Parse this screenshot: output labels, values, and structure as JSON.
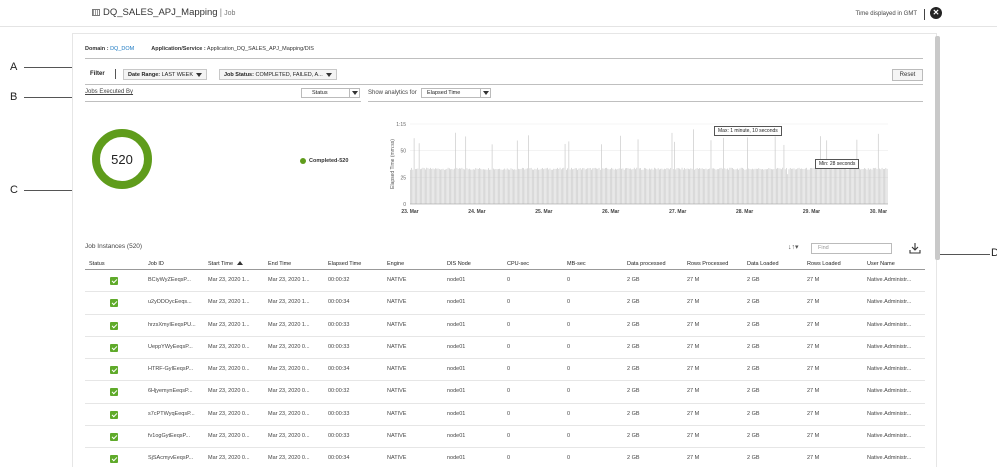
{
  "header": {
    "title": "DQ_SALES_APJ_Mapping",
    "subtitle": "Job",
    "time_note": "Time displayed in GMT"
  },
  "callouts": {
    "a": "A",
    "b": "B",
    "c": "C",
    "d": "D"
  },
  "domain": {
    "domain_label": "Domain :",
    "domain_value": "DQ_DOM",
    "service_label": "Application/Service :",
    "service_value": "Application_DQ_SALES_APJ_Mapping/DIS"
  },
  "filter": {
    "label": "Filter",
    "date_range_label": "Date Range:",
    "date_range_value": "LAST WEEK",
    "job_status_label": "Job Status:",
    "job_status_value": "COMPLETED, FAILED, A...",
    "reset_label": "Reset"
  },
  "summary": {
    "jobs_executed_by": "Jobs Executed By",
    "group_by_select": "Status",
    "analytics_label": "Show analytics for",
    "analytics_select": "Elapsed Time",
    "donut_total": "520",
    "donut_fraction_completed": 1.0,
    "legend": "Completed-520",
    "color_completed": "#5f9c1b"
  },
  "chart_data": {
    "type": "bar",
    "ylabel": "Elapsed Time (mm:ss)",
    "y_ticks": [
      "0",
      "25",
      "50",
      "1:15"
    ],
    "x_ticks": [
      "23. Mar",
      "24. Mar",
      "25. Mar",
      "26. Mar",
      "27. Mar",
      "28. Mar",
      "29. Mar",
      "30. Mar"
    ],
    "ylim_seconds": [
      0,
      75
    ],
    "bar_count": 520,
    "typical_value_seconds": 33,
    "max_tooltip": "Max: 1 minute, 10 seconds",
    "min_tooltip": "Min: 28 seconds",
    "max_value_seconds": 70,
    "min_value_seconds": 28
  },
  "table": {
    "title": "Job Instances (520)",
    "find_placeholder": "Find",
    "sort_icon": "sort-icon",
    "download_icon": "download-icon",
    "columns": [
      "Status",
      "Job ID",
      "Start Time",
      "End Time",
      "Elapsed Time",
      "Engine",
      "DIS Node",
      "CPU-sec",
      "MB-sec",
      "Data processed",
      "Rows Processed",
      "Data Loaded",
      "Rows Loaded",
      "User Name"
    ],
    "rows": [
      [
        "",
        "BCiyWyZEeqsP...",
        "Mar 23, 2020 1...",
        "Mar 23, 2020 1...",
        "00:00:32",
        "NATIVE",
        "node01",
        "0",
        "0",
        "2 GB",
        "27 M",
        "2 GB",
        "27 M",
        "Native.Administr..."
      ],
      [
        "",
        "u2yDDOycEeqs...",
        "Mar 23, 2020 1...",
        "Mar 23, 2020 1...",
        "00:00:34",
        "NATIVE",
        "node01",
        "0",
        "0",
        "2 GB",
        "27 M",
        "2 GB",
        "27 M",
        "Native.Administr..."
      ],
      [
        "",
        "hrzsXmyIEeqsPU...",
        "Mar 23, 2020 1...",
        "Mar 23, 2020 1...",
        "00:00:33",
        "NATIVE",
        "node01",
        "0",
        "0",
        "2 GB",
        "27 M",
        "2 GB",
        "27 M",
        "Native.Administr..."
      ],
      [
        "",
        "UeppYWyEeqsP...",
        "Mar 23, 2020 0...",
        "Mar 23, 2020 0...",
        "00:00:33",
        "NATIVE",
        "node01",
        "0",
        "0",
        "2 GB",
        "27 M",
        "2 GB",
        "27 M",
        "Native.Administr..."
      ],
      [
        "",
        "HTRF-GyIEeqsP...",
        "Mar 23, 2020 0...",
        "Mar 23, 2020 0...",
        "00:00:34",
        "NATIVE",
        "node01",
        "0",
        "0",
        "2 GB",
        "27 M",
        "2 GB",
        "27 M",
        "Native.Administr..."
      ],
      [
        "",
        "6HjyemynEeqsP...",
        "Mar 23, 2020 0...",
        "Mar 23, 2020 0...",
        "00:00:32",
        "NATIVE",
        "node01",
        "0",
        "0",
        "2 GB",
        "27 M",
        "2 GB",
        "27 M",
        "Native.Administr..."
      ],
      [
        "",
        "s7cPTWyqEeqsP...",
        "Mar 23, 2020 0...",
        "Mar 23, 2020 0...",
        "00:00:33",
        "NATIVE",
        "node01",
        "0",
        "0",
        "2 GB",
        "27 M",
        "2 GB",
        "27 M",
        "Native.Administr..."
      ],
      [
        "",
        "fv1ogGytEeqsP...",
        "Mar 23, 2020 0...",
        "Mar 23, 2020 0...",
        "00:00:33",
        "NATIVE",
        "node01",
        "0",
        "0",
        "2 GB",
        "27 M",
        "2 GB",
        "27 M",
        "Native.Administr..."
      ],
      [
        "",
        "SjSAcmyvEeqsP...",
        "Mar 23, 2020 0...",
        "Mar 23, 2020 0...",
        "00:00:34",
        "NATIVE",
        "node01",
        "0",
        "0",
        "2 GB",
        "27 M",
        "2 GB",
        "27 M",
        "Native.Administr..."
      ]
    ]
  }
}
